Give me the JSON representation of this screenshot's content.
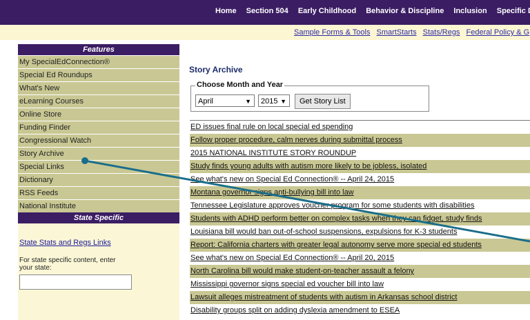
{
  "topnav": {
    "items": [
      "Home",
      "Section 504",
      "Early Childhood",
      "Behavior & Discipline",
      "Inclusion",
      "Specific Disab"
    ]
  },
  "subnav": {
    "items": [
      "Sample Forms & Tools",
      "SmartStarts",
      "Stats/Regs",
      "Federal Policy & G"
    ]
  },
  "sidebar": {
    "features_header": "Features",
    "items": [
      "My SpecialEdConnection®",
      "Special Ed Roundups",
      "What's New",
      "eLearning Courses",
      "Online Store",
      "Funding Finder",
      "Congressional Watch",
      "Story Archive",
      "Special Links",
      "Dictionary",
      "RSS Feeds",
      "National Institute"
    ],
    "state_header": "State Specific",
    "state_link": "State Stats and Regs Links",
    "state_text": "For state specific content, enter your state:",
    "state_input_value": ""
  },
  "main": {
    "title": "Story Archive",
    "legend": "Choose Month and Year",
    "month_selected": "April",
    "year_selected": "2015",
    "button_label": "Get Story List",
    "stories": [
      "ED issues final rule on local special ed spending",
      "Follow proper procedure, calm nerves during submittal process",
      "2015 NATIONAL INSTITUTE STORY ROUNDUP",
      "Study finds young adults with autism more likely to be jobless, isolated",
      "See what's new on Special Ed Connection® -- April 24, 2015",
      "Montana governor signs anti-bullying bill into law",
      "Tennessee Legislature approves voucher program for some students with disabilities",
      "Students with ADHD perform better on complex tasks when they can fidget, study finds",
      "Louisiana bill would ban out-of-school suspensions, expulsions for K-3 students",
      "Report: California charters with greater legal autonomy serve more special ed students",
      "See what's new on Special Ed Connection® -- April 20, 2015",
      "North Carolina bill would make student-on-teacher assault a felony",
      "Mississippi governor signs special ed voucher bill into law",
      "Lawsuit alleges mistreatment of students with autism in Arkansas school district",
      "Disability groups split on adding dyslexia amendment to ESEA"
    ]
  },
  "colors": {
    "purple": "#3b1d63",
    "olive": "#c9c894",
    "cream": "#fbf7d6",
    "arrow": "#1a6e8a"
  }
}
